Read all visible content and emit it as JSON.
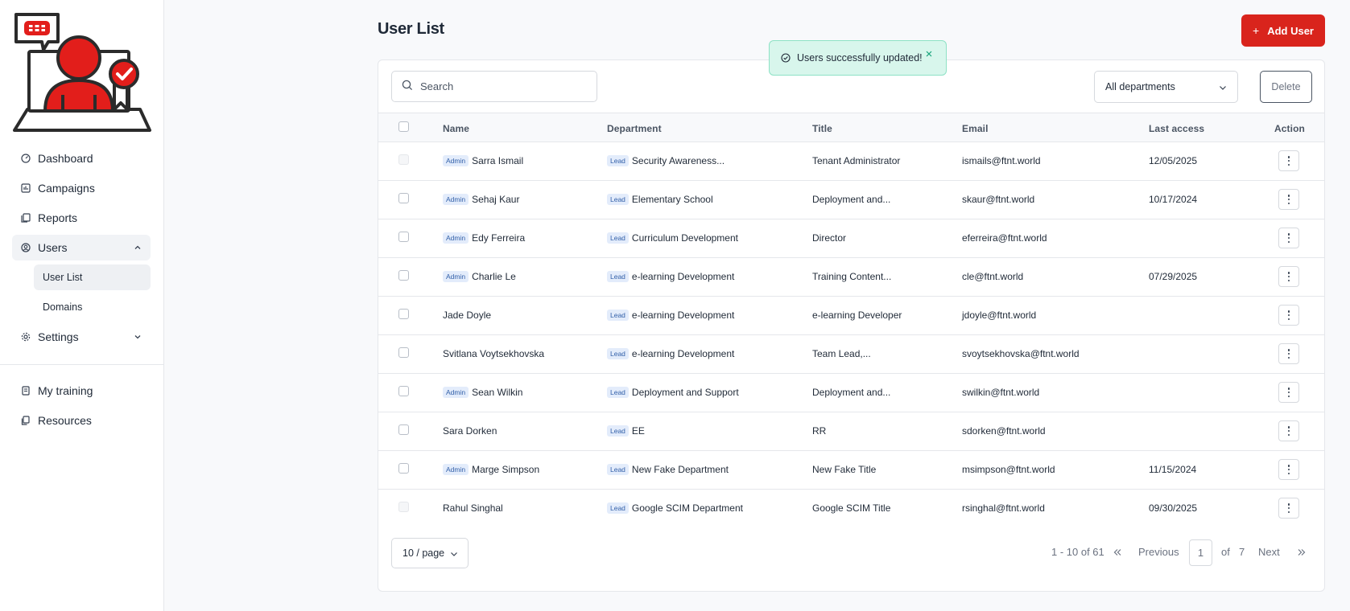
{
  "sidebar": {
    "logo": "fortinet-user-training-logo",
    "nav": [
      {
        "label": "Dashboard",
        "icon": "gauge-icon"
      },
      {
        "label": "Campaigns",
        "icon": "chart-icon"
      },
      {
        "label": "Reports",
        "icon": "files-icon"
      },
      {
        "label": "Users",
        "icon": "user-circle-icon",
        "expanded": true,
        "children": [
          {
            "label": "User List",
            "active": true
          },
          {
            "label": "Domains"
          }
        ]
      },
      {
        "label": "Settings",
        "icon": "gear-icon",
        "expanded": false
      }
    ],
    "secondary": [
      {
        "label": "My training",
        "icon": "book-icon"
      },
      {
        "label": "Resources",
        "icon": "resources-icon"
      }
    ]
  },
  "header": {
    "title": "User List",
    "add_button": "Add User",
    "accent_color": "#d9241c"
  },
  "toast": {
    "message": "Users successfully updated!",
    "color": "#d8f6ec"
  },
  "toolbar": {
    "search_placeholder": "Search",
    "department_filter": "All departments",
    "delete_button": "Delete"
  },
  "table": {
    "columns": [
      "Name",
      "Department",
      "Title",
      "Email",
      "Last access",
      "Action"
    ],
    "rows": [
      {
        "admin": "Admin",
        "name": "Sarra Ismail",
        "lead": "Lead",
        "department": "Security Awareness...",
        "title": "Tenant Administrator",
        "email": "ismails@ftnt.world",
        "last_access": "12/05/2025",
        "disabled": true
      },
      {
        "admin": "Admin",
        "name": "Sehaj Kaur",
        "lead": "Lead",
        "department": "Elementary School",
        "title": "Deployment and...",
        "email": "skaur@ftnt.world",
        "last_access": "10/17/2024",
        "disabled": false
      },
      {
        "admin": "Admin",
        "name": "Edy Ferreira",
        "lead": "Lead",
        "department": "Curriculum Development",
        "title": "Director",
        "email": "eferreira@ftnt.world",
        "last_access": "",
        "disabled": false
      },
      {
        "admin": "Admin",
        "name": "Charlie Le",
        "lead": "Lead",
        "department": "e-learning Development",
        "title": "Training Content...",
        "email": "cle@ftnt.world",
        "last_access": "07/29/2025",
        "disabled": false
      },
      {
        "admin": "",
        "name": "Jade Doyle",
        "lead": "Lead",
        "department": "e-learning Development",
        "title": "e-learning Developer",
        "email": "jdoyle@ftnt.world",
        "last_access": "",
        "disabled": false
      },
      {
        "admin": "",
        "name": "Svitlana Voytsekhovska",
        "lead": "Lead",
        "department": "e-learning Development",
        "title": "Team Lead,...",
        "email": "svoytsekhovska@ftnt.world",
        "last_access": "",
        "disabled": false
      },
      {
        "admin": "Admin",
        "name": "Sean Wilkin",
        "lead": "Lead",
        "department": "Deployment and Support",
        "title": "Deployment and...",
        "email": "swilkin@ftnt.world",
        "last_access": "",
        "disabled": false
      },
      {
        "admin": "",
        "name": "Sara Dorken",
        "lead": "Lead",
        "department": "EE",
        "title": "RR",
        "email": "sdorken@ftnt.world",
        "last_access": "",
        "disabled": false
      },
      {
        "admin": "Admin",
        "name": "Marge Simpson",
        "lead": "Lead",
        "department": "New Fake Department",
        "title": "New Fake Title",
        "email": "msimpson@ftnt.world",
        "last_access": "11/15/2024",
        "disabled": false
      },
      {
        "admin": "",
        "name": "Rahul Singhal",
        "lead": "Lead",
        "department": "Google SCIM Department",
        "title": "Google SCIM Title",
        "email": "rsinghal@ftnt.world",
        "last_access": "09/30/2025",
        "disabled": true
      }
    ]
  },
  "pagination": {
    "per_page": "10 / page",
    "range": "1 - 10 of 61",
    "previous": "Previous",
    "current_page": "1",
    "of": "of",
    "total_pages": "7",
    "next": "Next"
  }
}
